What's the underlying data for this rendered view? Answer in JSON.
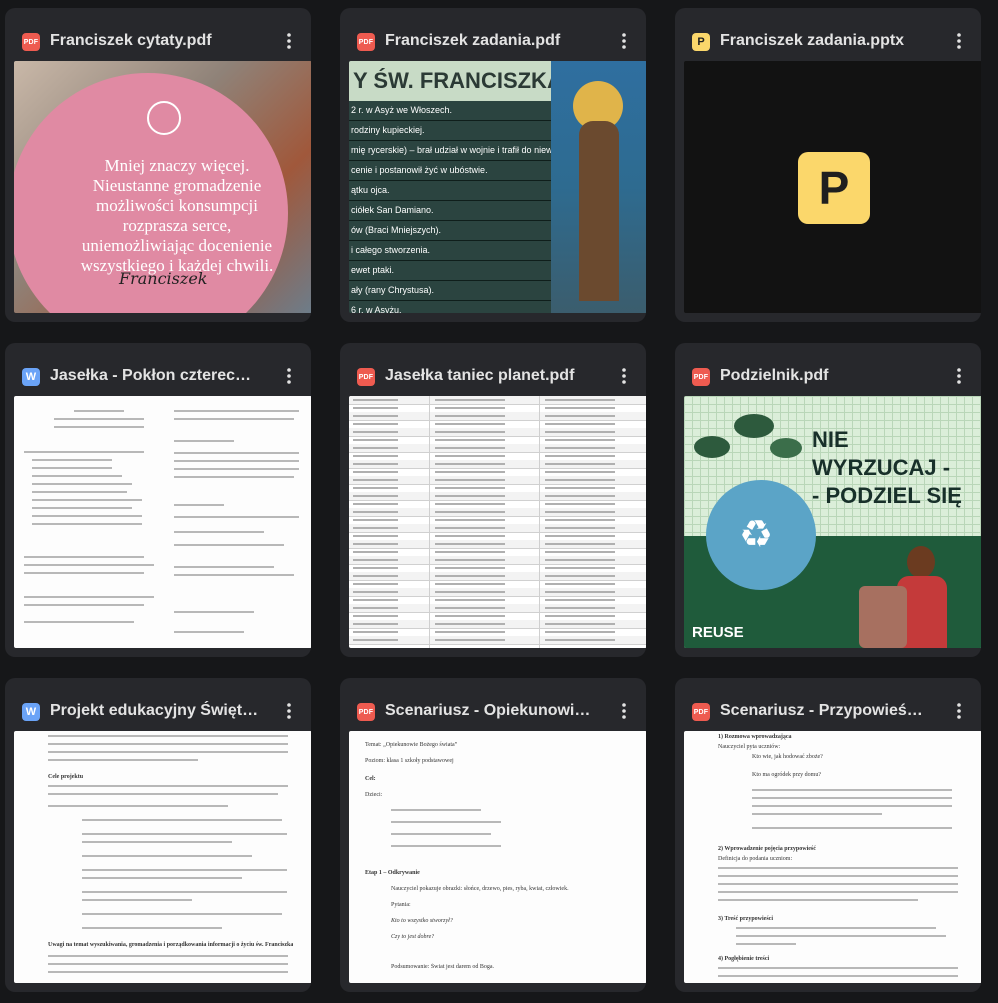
{
  "cards": [
    {
      "title": "Franciszek cytaty.pdf",
      "type": "PDF"
    },
    {
      "title": "Franciszek zadania.pdf",
      "type": "PDF"
    },
    {
      "title": "Franciszek zadania.pptx",
      "type": "P"
    },
    {
      "title": "Jasełka - Pokłon czterech ...",
      "type": "W"
    },
    {
      "title": "Jasełka taniec planet.pdf",
      "type": "PDF"
    },
    {
      "title": "Podzielnik.pdf",
      "type": "PDF"
    },
    {
      "title": "Projekt edukacyjny Święty ...",
      "type": "W"
    },
    {
      "title": "Scenariusz - Opiekunowie ...",
      "type": "PDF"
    },
    {
      "title": "Scenariusz - Przypowieść o ...",
      "type": "PDF"
    }
  ],
  "thumbs": {
    "quote": {
      "text": "Mniej znaczy więcej. Nieustanne gromadzenie możliwości konsumpcji rozprasza serce, uniemożliwiając docenienie wszystkiego i każdej chwili.",
      "sign": "Franciszek"
    },
    "slide": {
      "title": "Y ŚW. FRANCISZKA",
      "rows": [
        "2 r. w Asyż we Włoszech.",
        "rodziny kupieckiej.",
        "mię rycerskie) – brał udział w wojnie i trafił do niewoli.",
        "cenie i postanowił żyć w ubóstwie.",
        "ątku ojca.",
        "ciółek San Damiano.",
        "ów (Braci Mniejszych).",
        "i całego stworzenia.",
        "ewet ptaki.",
        "ały (rany Chrystusa).",
        "6 r. w Asyżu."
      ]
    },
    "ppt": {
      "letter": "P"
    },
    "pod": {
      "title1": "NIE",
      "title2": "WYRZUCAJ -",
      "title3": "- PODZIEL SIĘ",
      "reuse": "REUSE"
    },
    "scen1": {
      "lines": [
        "Temat: „Opiekunowie Bożego świata”",
        "Poziom: klasa 1 szkoły podstawowej",
        "Cel:",
        "Dzieci:",
        "Etap 1 – Odkrywanie",
        "Nauczyciel pokazuje obrazki: słońce, drzewo, pies, ryba, kwiat, człowiek.",
        "Pytania:",
        "Kto to wszystko stworzył?",
        "Czy to jest dobre?",
        "Podsumowanie: Świat jest darem od Boga."
      ]
    },
    "scen2": {
      "lines": [
        "1) Rozmowa wprowadzająca",
        "Nauczyciel pyta uczniów:",
        "Kto wie, jak hodować zboże?",
        "Kto ma ogródek przy domu?",
        "2) Wprowadzenie pojęcia przypowieść",
        "Definicja do podania uczniom:",
        "3) Treść przypowieści",
        "4) Pogłębienie treści"
      ]
    },
    "proj": {
      "lines": [
        "Cele projektu",
        "Uwagi na temat wyszukiwania, gromadzenia i porządkowania informacji o życiu św. Franciszka"
      ]
    }
  }
}
